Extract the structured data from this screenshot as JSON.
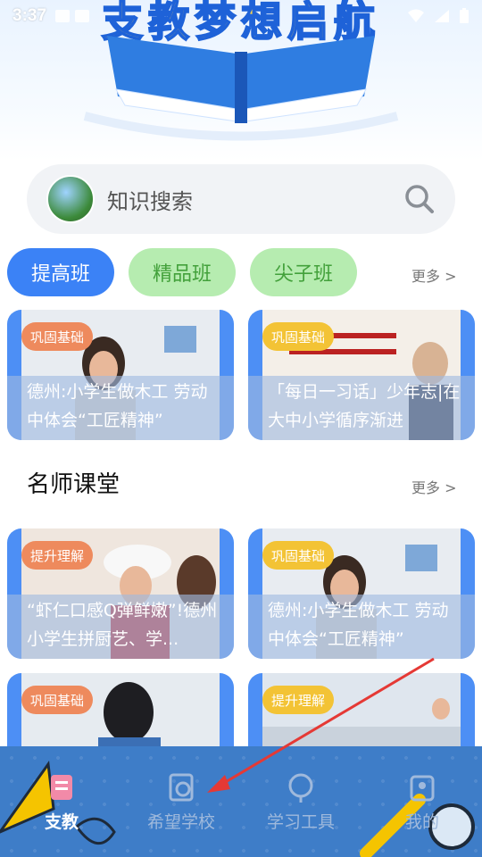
{
  "status_bar": {
    "time": "3:37"
  },
  "banner": {
    "title": "支教梦想启航"
  },
  "search": {
    "placeholder": "知识搜索"
  },
  "class_tabs": [
    {
      "label": "提高班"
    },
    {
      "label": "精品班"
    },
    {
      "label": "尖子班"
    }
  ],
  "class_more": "更多 >",
  "class_cards": [
    {
      "tag": "巩固基础",
      "title": "德州:小学生做木工 劳动中体会“工匠精神”"
    },
    {
      "tag": "巩固基础",
      "title": "「每日一习话」少年志|在大中小学循序渐进"
    }
  ],
  "section": {
    "title": "名师课堂",
    "more": "更多 >"
  },
  "teacher_cards": [
    {
      "tag": "提升理解",
      "title": "“虾仁口感Q弹鲜嫩”!德州小学生拼厨艺、学..."
    },
    {
      "tag": "巩固基础",
      "title": "德州:小学生做木工 劳动中体会“工匠精神”"
    },
    {
      "tag": "巩固基础",
      "title": ""
    },
    {
      "tag": "提升理解",
      "title": ""
    }
  ],
  "bottom_nav": [
    {
      "label": "支教",
      "icon": "teach-icon",
      "active": true
    },
    {
      "label": "希望学校",
      "icon": "school-icon",
      "active": false
    },
    {
      "label": "学习工具",
      "icon": "globe-icon",
      "active": false
    },
    {
      "label": "我的",
      "icon": "profile-icon",
      "active": false
    }
  ],
  "colors": {
    "accent": "#3b82f6",
    "green_tab": "#b6ecb0",
    "nav_bg": "#3e7dc8",
    "arrow": "#e53935"
  }
}
